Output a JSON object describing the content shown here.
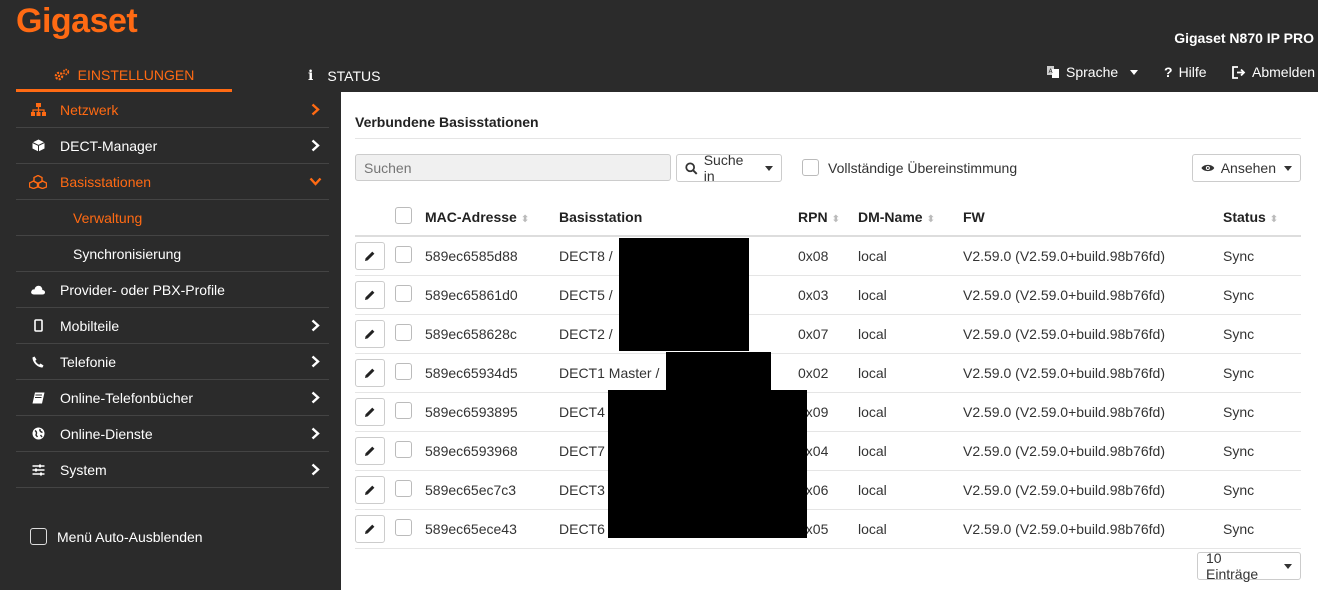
{
  "header": {
    "logo": "Gigaset",
    "model": "Gigaset N870 IP PRO",
    "tabs": [
      {
        "label": "EINSTELLUNGEN"
      },
      {
        "label": "STATUS"
      }
    ],
    "language_label": "Sprache",
    "help_label": "Hilfe",
    "logout_label": "Abmelden"
  },
  "sidebar": {
    "items": [
      {
        "label": "Netzwerk",
        "icon": "network-icon"
      },
      {
        "label": "DECT-Manager",
        "icon": "cube-icon"
      },
      {
        "label": "Basisstationen",
        "icon": "cubes-icon"
      },
      {
        "label": "Verwaltung"
      },
      {
        "label": "Synchronisierung"
      },
      {
        "label": "Provider- oder PBX-Profile",
        "icon": "cloud-icon"
      },
      {
        "label": "Mobilteile",
        "icon": "mobile-icon"
      },
      {
        "label": "Telefonie",
        "icon": "phone-icon"
      },
      {
        "label": "Online-Telefonbücher",
        "icon": "book-icon"
      },
      {
        "label": "Online-Dienste",
        "icon": "globe-icon"
      },
      {
        "label": "System",
        "icon": "sliders-icon"
      }
    ],
    "autohide_label": "Menü Auto-Ausblenden"
  },
  "main": {
    "title": "Verbundene Basisstationen",
    "search_placeholder": "Suchen",
    "search_in_label": "Suche in",
    "full_match_label": "Vollständige Übereinstimmung",
    "view_label": "Ansehen",
    "entries_label": "10 Einträge",
    "columns": [
      "MAC-Adresse",
      "Basisstation",
      "RPN",
      "DM-Name",
      "FW",
      "Status"
    ],
    "rows": [
      {
        "mac": "589ec6585d88",
        "station": "DECT8 /",
        "rpn": "0x08",
        "dm": "local",
        "fw": "V2.59.0 (V2.59.0+build.98b76fd)",
        "status": "Sync"
      },
      {
        "mac": "589ec65861d0",
        "station": "DECT5 /",
        "rpn": "0x03",
        "dm": "local",
        "fw": "V2.59.0 (V2.59.0+build.98b76fd)",
        "status": "Sync"
      },
      {
        "mac": "589ec658628c",
        "station": "DECT2 /",
        "rpn": "0x07",
        "dm": "local",
        "fw": "V2.59.0 (V2.59.0+build.98b76fd)",
        "status": "Sync"
      },
      {
        "mac": "589ec65934d5",
        "station": "DECT1 Master /",
        "rpn": "0x02",
        "dm": "local",
        "fw": "V2.59.0 (V2.59.0+build.98b76fd)",
        "status": "Sync"
      },
      {
        "mac": "589ec6593895",
        "station": "DECT4",
        "rpn": "0x09",
        "dm": "local",
        "fw": "V2.59.0 (V2.59.0+build.98b76fd)",
        "status": "Sync"
      },
      {
        "mac": "589ec6593968",
        "station": "DECT7",
        "rpn": "0x04",
        "dm": "local",
        "fw": "V2.59.0 (V2.59.0+build.98b76fd)",
        "status": "Sync"
      },
      {
        "mac": "589ec65ec7c3",
        "station": "DECT3",
        "rpn": "0x06",
        "dm": "local",
        "fw": "V2.59.0 (V2.59.0+build.98b76fd)",
        "status": "Sync"
      },
      {
        "mac": "589ec65ece43",
        "station": "DECT6",
        "rpn": "0x05",
        "dm": "local",
        "fw": "V2.59.0 (V2.59.0+build.98b76fd)",
        "status": "Sync"
      }
    ]
  },
  "colors": {
    "accent": "#ff6a13",
    "dark": "#2b2b2b"
  }
}
